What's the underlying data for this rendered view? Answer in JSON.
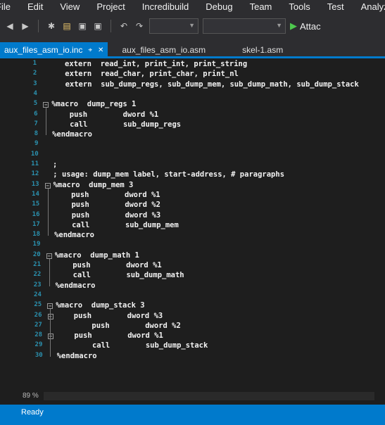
{
  "menu": [
    "File",
    "Edit",
    "View",
    "Project",
    "Incredibuild",
    "Debug",
    "Team",
    "Tools",
    "Test",
    "Analyze"
  ],
  "toolbar": {
    "attach_label": "Attac",
    "icons": [
      "back-icon",
      "forward-icon",
      "new-project-icon",
      "open-icon",
      "save-icon",
      "save-all-icon",
      "undo-icon",
      "redo-icon"
    ]
  },
  "tabs": [
    {
      "label": "aux_files_asm_io.inc",
      "active": true
    },
    {
      "label": "aux_files_asm_io.asm",
      "active": false
    },
    {
      "label": "skel-1.asm",
      "active": false
    }
  ],
  "editor": {
    "lines": [
      {
        "n": "1",
        "text": "extern  read_int, print_int, print_string"
      },
      {
        "n": "2",
        "text": "extern  read_char, print_char, print_nl"
      },
      {
        "n": "3",
        "text": "extern  sub_dump_regs, sub_dump_mem, sub_dump_math, sub_dump_stack"
      },
      {
        "n": "4",
        "text": ""
      },
      {
        "n": "5",
        "text": "%macro  dump_regs 1"
      },
      {
        "n": "6",
        "text": "    push        dword %1"
      },
      {
        "n": "7",
        "text": "    call        sub_dump_regs"
      },
      {
        "n": "8",
        "text": "%endmacro"
      },
      {
        "n": "9",
        "text": ""
      },
      {
        "n": "10",
        "text": ""
      },
      {
        "n": "11",
        "text": ";"
      },
      {
        "n": "12",
        "text": "; usage: dump_mem label, start-address, # paragraphs"
      },
      {
        "n": "13",
        "text": "%macro  dump_mem 3"
      },
      {
        "n": "14",
        "text": "    push        dword %1"
      },
      {
        "n": "15",
        "text": "    push        dword %2"
      },
      {
        "n": "16",
        "text": "    push        dword %3"
      },
      {
        "n": "17",
        "text": "    call        sub_dump_mem"
      },
      {
        "n": "18",
        "text": "%endmacro"
      },
      {
        "n": "19",
        "text": ""
      },
      {
        "n": "20",
        "text": "%macro  dump_math 1"
      },
      {
        "n": "21",
        "text": "    push        dword %1"
      },
      {
        "n": "22",
        "text": "    call        sub_dump_math"
      },
      {
        "n": "23",
        "text": "%endmacro"
      },
      {
        "n": "24",
        "text": ""
      },
      {
        "n": "25",
        "text": "%macro  dump_stack 3"
      },
      {
        "n": "26",
        "text": "    push        dword %3"
      },
      {
        "n": "27",
        "text": "        push        dword %2"
      },
      {
        "n": "28",
        "text": "    push        dword %1"
      },
      {
        "n": "29",
        "text": "        call        sub_dump_stack"
      },
      {
        "n": "30",
        "text": "%endmacro"
      }
    ]
  },
  "status": {
    "zoom": "89 %",
    "state": "Ready"
  },
  "colors": {
    "accent": "#007acc",
    "line_number": "#2b91af",
    "editor_bg": "#1e1e1e",
    "chrome_bg": "#2d2d30"
  }
}
